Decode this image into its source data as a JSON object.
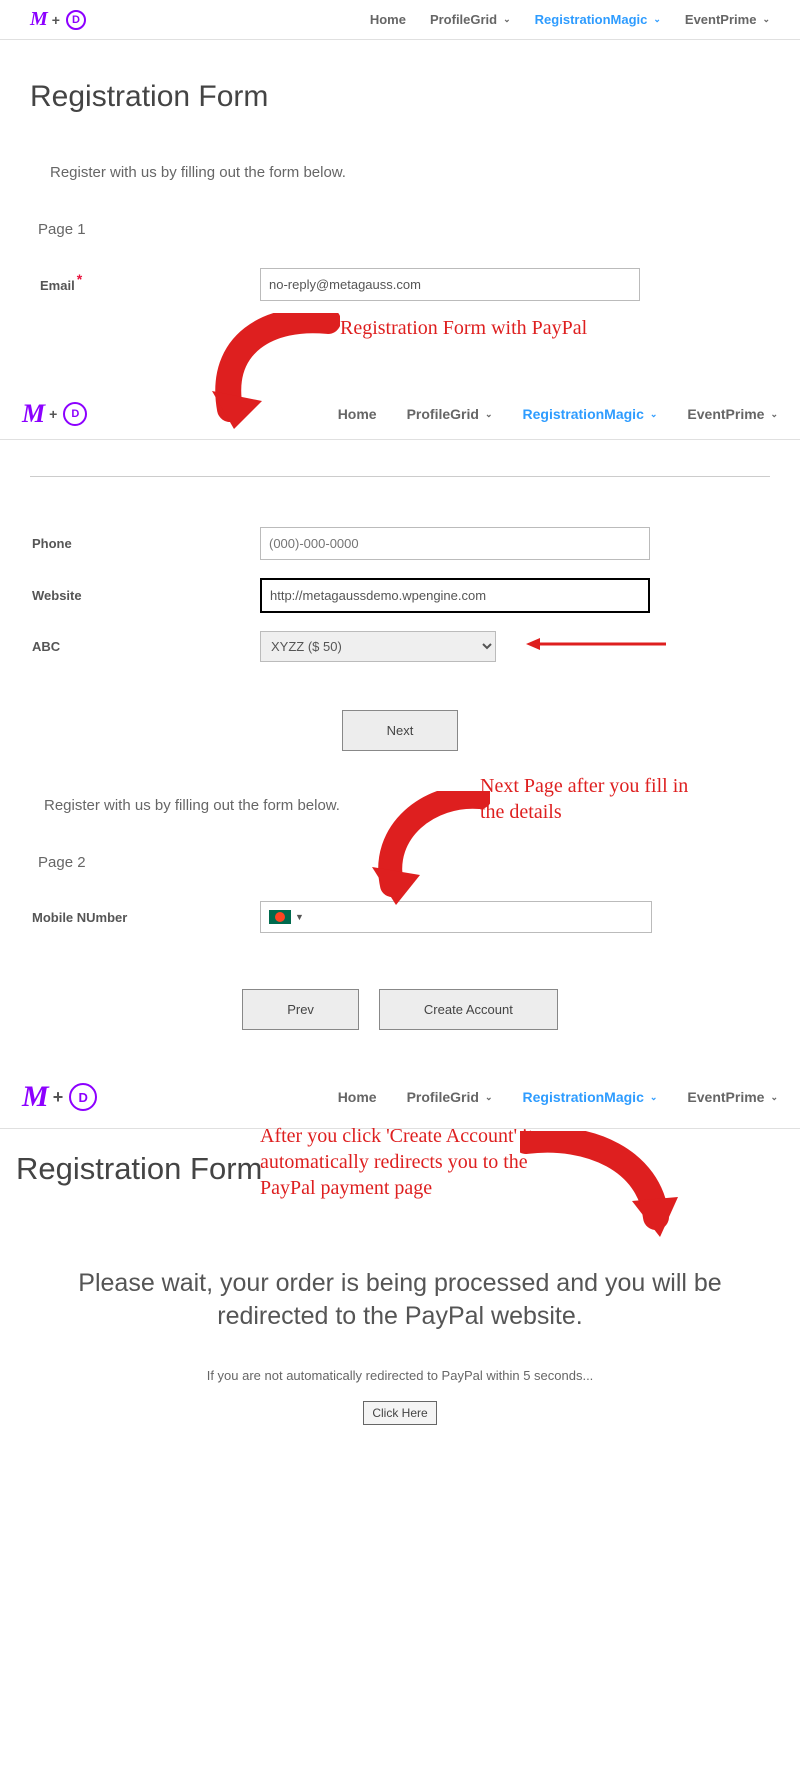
{
  "nav": {
    "items": [
      {
        "label": "Home",
        "active": false,
        "dd": false
      },
      {
        "label": "ProfileGrid",
        "active": false,
        "dd": true
      },
      {
        "label": "RegistrationMagic",
        "active": true,
        "dd": true
      },
      {
        "label": "EventPrime",
        "active": false,
        "dd": true
      }
    ]
  },
  "section1": {
    "title": "Registration Form",
    "intro": "Register with us by filling out the form below.",
    "page_label": "Page 1",
    "email_label": "Email",
    "email_value": "no-reply@metagauss.com"
  },
  "annot1": "Registration Form with PayPal",
  "section2": {
    "phone_label": "Phone",
    "phone_placeholder": "(000)-000-0000",
    "website_label": "Website",
    "website_value": "http://metagaussdemo.wpengine.com",
    "abc_label": "ABC",
    "abc_option": "XYZZ ($ 50)",
    "next_btn": "Next"
  },
  "section_p2": {
    "intro": "Register with us by filling out the form below.",
    "page_label": "Page 2",
    "mobile_label": "Mobile NUmber",
    "prev_btn": "Prev",
    "create_btn": "Create Account"
  },
  "annot2": "Next Page after you fill in the details",
  "section3": {
    "title": "Registration Form",
    "wait": "Please wait, your order is being processed and you will be redirected to the PayPal website.",
    "hint": "If you are not automatically redirected to PayPal within 5 seconds...",
    "click": "Click Here"
  },
  "annot3": "After you click 'Create Account' it automatically redirects you to the PayPal payment page"
}
